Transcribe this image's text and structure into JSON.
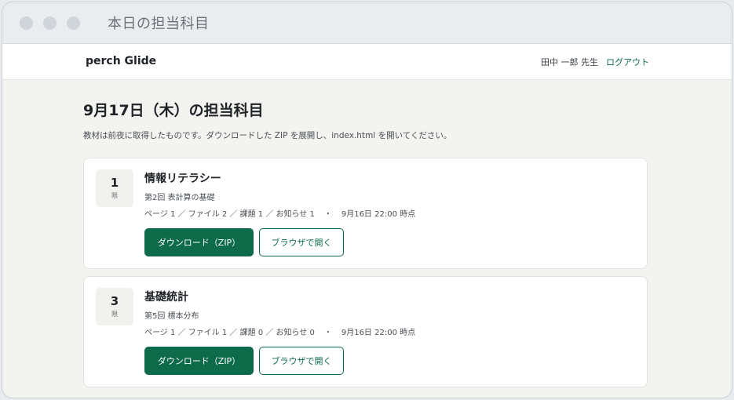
{
  "window": {
    "title": "本日の担当科目"
  },
  "header": {
    "brand": "perch Glide",
    "user_name": "田中 一郎 先生",
    "logout_label": "ログアウト"
  },
  "main": {
    "title": "9月17日（木）の担当科目",
    "description": "教材は前夜に取得したものです。ダウンロードした ZIP を展開し、index.html を開いてください。"
  },
  "courses": [
    {
      "period": "1",
      "period_unit": "限",
      "subject": "情報リテラシー",
      "session": "第2回 表計算の基礎",
      "counts": "ページ 1 ／ ファイル 2 ／ 課題 1 ／ お知らせ 1",
      "separator": "・",
      "timestamp": "9月16日 22:00 時点",
      "download_label": "ダウンロード（ZIP）",
      "open_label": "ブラウザで開く"
    },
    {
      "period": "3",
      "period_unit": "限",
      "subject": "基礎統計",
      "session": "第5回 標本分布",
      "counts": "ページ 1 ／ ファイル 1 ／ 課題 0 ／ お知らせ 0",
      "separator": "・",
      "timestamp": "9月16日 22:00 時点",
      "download_label": "ダウンロード（ZIP）",
      "open_label": "ブラウザで開く"
    }
  ],
  "colors": {
    "accent": "#0e6b4a",
    "window_chrome": "#e9edf0",
    "page_background": "#f3f3f0"
  }
}
